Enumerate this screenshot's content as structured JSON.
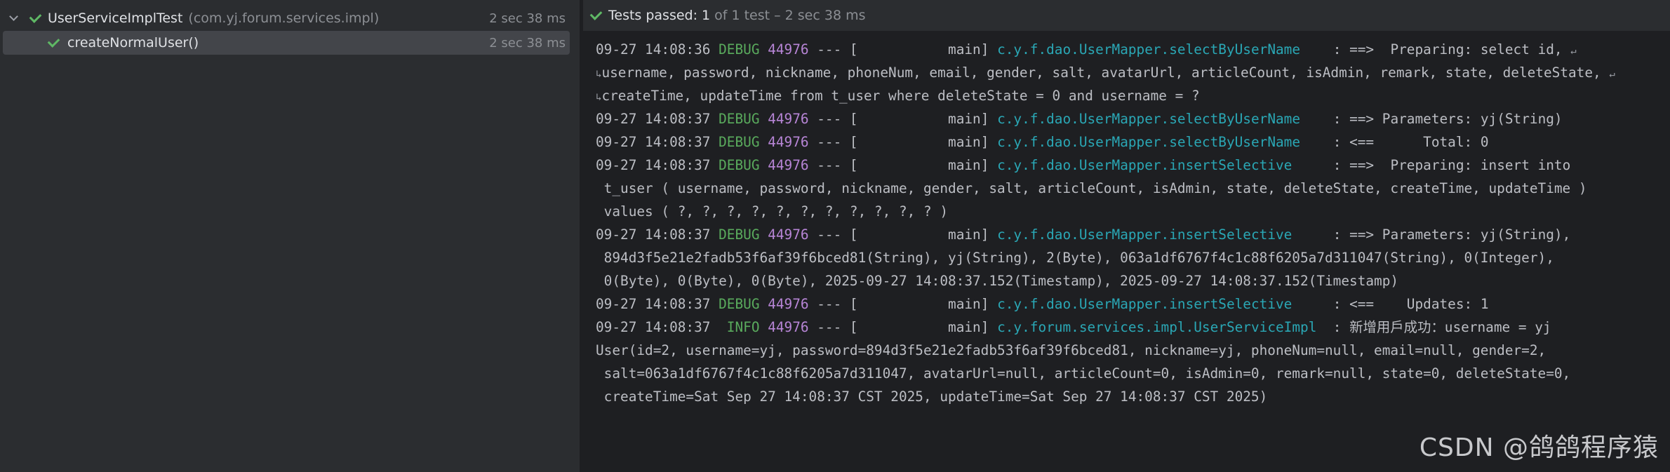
{
  "test_tree": {
    "suite": {
      "name": "UserServiceImplTest",
      "package": "(com.yj.forum.services.impl)",
      "time": "2 sec 38 ms"
    },
    "test": {
      "name": "createNormalUser()",
      "time": "2 sec 38 ms"
    }
  },
  "toolbar": {
    "status_label": "Tests passed:",
    "passed_count": "1",
    "detail": "of 1 test – 2 sec 38 ms"
  },
  "console_lines": [
    [
      {
        "t": "09-27 14:08:36 "
      },
      {
        "t": "DEBUG",
        "c": "debug"
      },
      {
        "t": " "
      },
      {
        "t": "44976",
        "c": "pid"
      },
      {
        "t": " --- [           main] "
      },
      {
        "t": "c.y.f.dao.UserMapper.selectByUserName",
        "c": "logger"
      },
      {
        "t": "    : ==>  Preparing: select id, "
      },
      {
        "t": "↵",
        "c": "wrapicon"
      }
    ],
    [
      {
        "t": "↳",
        "c": "wrapicon"
      },
      {
        "t": "username, password, nickname, phoneNum, email, gender, salt, avatarUrl, articleCount, isAdmin, remark, state, deleteState, "
      },
      {
        "t": "↵",
        "c": "wrapicon"
      }
    ],
    [
      {
        "t": "↳",
        "c": "wrapicon"
      },
      {
        "t": "createTime, updateTime from t_user where deleteState = 0 and username = ?"
      }
    ],
    [
      {
        "t": "09-27 14:08:37 "
      },
      {
        "t": "DEBUG",
        "c": "debug"
      },
      {
        "t": " "
      },
      {
        "t": "44976",
        "c": "pid"
      },
      {
        "t": " --- [           main] "
      },
      {
        "t": "c.y.f.dao.UserMapper.selectByUserName",
        "c": "logger"
      },
      {
        "t": "    : ==> Parameters: yj(String)"
      }
    ],
    [
      {
        "t": "09-27 14:08:37 "
      },
      {
        "t": "DEBUG",
        "c": "debug"
      },
      {
        "t": " "
      },
      {
        "t": "44976",
        "c": "pid"
      },
      {
        "t": " --- [           main] "
      },
      {
        "t": "c.y.f.dao.UserMapper.selectByUserName",
        "c": "logger"
      },
      {
        "t": "    : <==      Total: 0"
      }
    ],
    [
      {
        "t": "09-27 14:08:37 "
      },
      {
        "t": "DEBUG",
        "c": "debug"
      },
      {
        "t": " "
      },
      {
        "t": "44976",
        "c": "pid"
      },
      {
        "t": " --- [           main] "
      },
      {
        "t": "c.y.f.dao.UserMapper.insertSelective",
        "c": "logger"
      },
      {
        "t": "     : ==>  Preparing: insert into"
      }
    ],
    [
      {
        "t": " t_user ( username, password, nickname, gender, salt, articleCount, isAdmin, state, deleteState, createTime, updateTime )"
      }
    ],
    [
      {
        "t": " values ( ?, ?, ?, ?, ?, ?, ?, ?, ?, ?, ? )"
      }
    ],
    [
      {
        "t": "09-27 14:08:37 "
      },
      {
        "t": "DEBUG",
        "c": "debug"
      },
      {
        "t": " "
      },
      {
        "t": "44976",
        "c": "pid"
      },
      {
        "t": " --- [           main] "
      },
      {
        "t": "c.y.f.dao.UserMapper.insertSelective",
        "c": "logger"
      },
      {
        "t": "     : ==> Parameters: yj(String),"
      }
    ],
    [
      {
        "t": " 894d3f5e21e2fadb53f6af39f6bced81(String), yj(String), 2(Byte), 063a1df6767f4c1c88f6205a7d311047(String), 0(Integer),"
      }
    ],
    [
      {
        "t": " 0(Byte), 0(Byte), 0(Byte), 2025-09-27 14:08:37.152(Timestamp), 2025-09-27 14:08:37.152(Timestamp)"
      }
    ],
    [
      {
        "t": "09-27 14:08:37 "
      },
      {
        "t": "DEBUG",
        "c": "debug"
      },
      {
        "t": " "
      },
      {
        "t": "44976",
        "c": "pid"
      },
      {
        "t": " --- [           main] "
      },
      {
        "t": "c.y.f.dao.UserMapper.insertSelective",
        "c": "logger"
      },
      {
        "t": "     : <==    Updates: 1"
      }
    ],
    [
      {
        "t": "09-27 14:08:37  "
      },
      {
        "t": "INFO",
        "c": "info"
      },
      {
        "t": " "
      },
      {
        "t": "44976",
        "c": "pid"
      },
      {
        "t": " --- [           main] "
      },
      {
        "t": "c.y.forum.services.impl.UserServiceImpl",
        "c": "logger"
      },
      {
        "t": "  : 新增用戶成功：username = yj"
      }
    ],
    [
      {
        "t": "User(id=2, username=yj, password=894d3f5e21e2fadb53f6af39f6bced81, nickname=yj, phoneNum=null, email=null, gender=2,"
      }
    ],
    [
      {
        "t": " salt=063a1df6767f4c1c88f6205a7d311047, avatarUrl=null, articleCount=0, isAdmin=0, remark=null, state=0, deleteState=0,"
      }
    ],
    [
      {
        "t": " createTime=Sat Sep 27 14:08:37 CST 2025, updateTime=Sat Sep 27 14:08:37 CST 2025)"
      }
    ]
  ],
  "watermark": "CSDN @鸽鸽程序猿"
}
